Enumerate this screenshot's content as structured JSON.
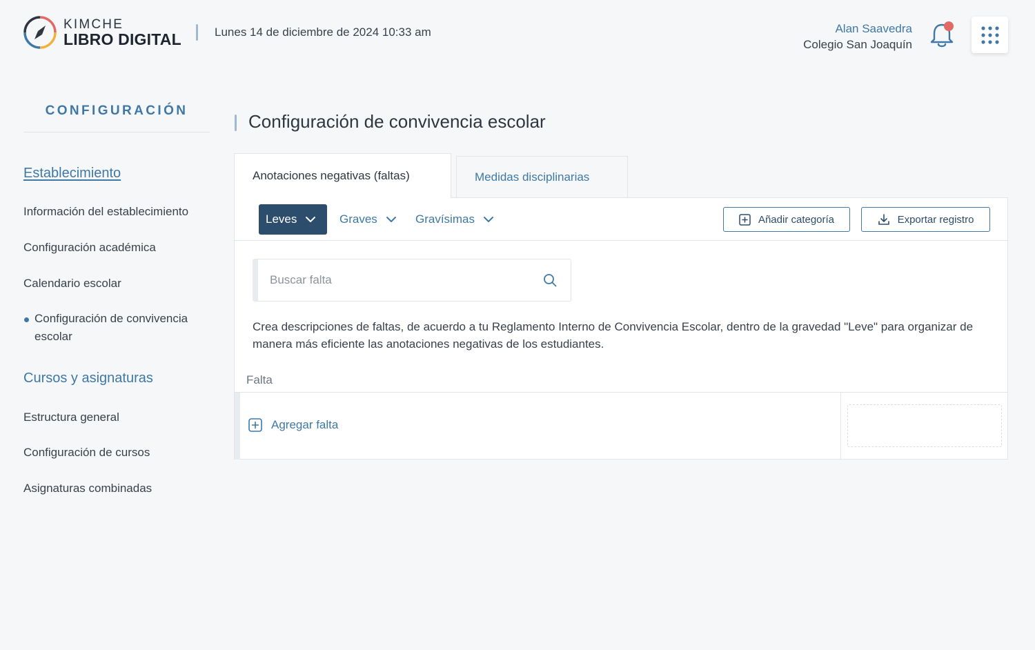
{
  "header": {
    "logo_top": "KIMCHE",
    "logo_bottom": "LIBRO DIGITAL",
    "date": "Lunes 14 de diciembre de 2024 10:33 am",
    "user_name": "Alan Saavedra",
    "school": "Colegio San Joaquín",
    "notification_icon": "bell-icon",
    "apps_icon": "grid-dots-icon"
  },
  "sidebar": {
    "title": "CONFIGURACIÓN",
    "sections": [
      {
        "label": "Establecimiento",
        "items": [
          "Información del establecimiento",
          "Configuración académica",
          "Calendario escolar",
          "Configuración de convivencia escolar"
        ]
      },
      {
        "label": "Cursos y asignaturas",
        "items": [
          "Estructura general",
          "Configuración de cursos",
          "Asignaturas combinadas"
        ]
      }
    ]
  },
  "main": {
    "title": "Configuración de convivencia escolar",
    "tabs": [
      {
        "label": "Anotaciones negativas (faltas)",
        "active": true
      },
      {
        "label": "Medidas disciplinarias",
        "active": false
      }
    ],
    "severity_filters": [
      {
        "label": "Leves",
        "selected": true
      },
      {
        "label": "Graves",
        "selected": false
      },
      {
        "label": "Gravísimas",
        "selected": false
      }
    ],
    "add_category_label": "Añadir categoría",
    "export_label": "Exportar registro",
    "search_placeholder": "Buscar falta",
    "description": "Crea descripciones de faltas, de acuerdo a tu Reglamento Interno de Convivencia Escolar, dentro de la gravedad \"Leve\" para organizar de manera más eficiente las anotaciones negativas de los estudiantes.",
    "column_header": "Falta",
    "add_falta_label": "Agregar falta"
  },
  "colors": {
    "accent": "#3f78a6",
    "primary_dark": "#2c4d6b",
    "notification_dot": "#e26a66"
  }
}
